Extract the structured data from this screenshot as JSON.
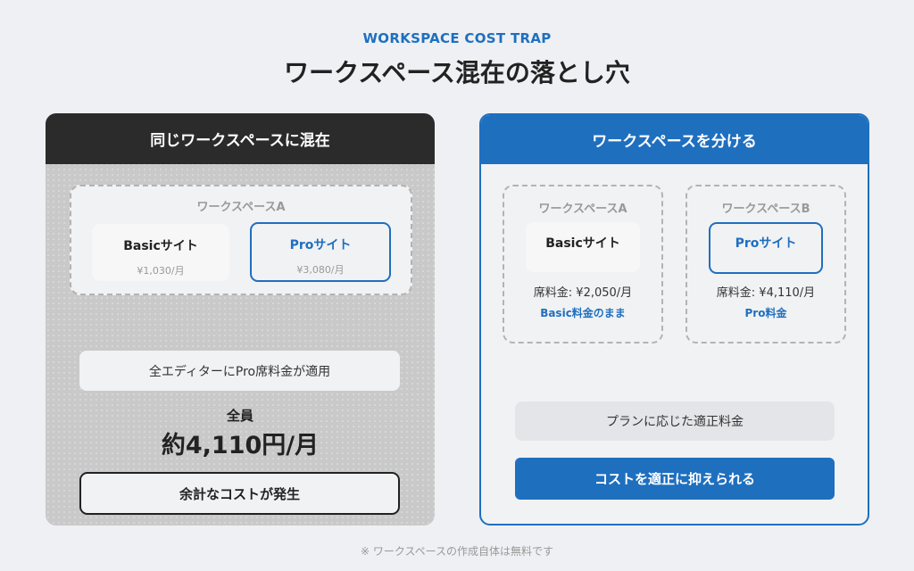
{
  "eyebrow": "WORKSPACE COST TRAP",
  "title": "ワークスペース混在の落とし穴",
  "left_panel": {
    "header": "同じワークスペースに混在",
    "workspace_label": "ワークスペースA",
    "basic_site": {
      "name": "Basicサイト",
      "price": "¥1,030/月"
    },
    "pro_site": {
      "name": "Proサイト",
      "price": "¥3,080/月"
    },
    "note": "全エディターにPro席料金が適用",
    "all_members": "全員",
    "total_price": "約4,110円/月",
    "result": "余計なコストが発生"
  },
  "right_panel": {
    "header": "ワークスペースを分ける",
    "workspace_a": {
      "label": "ワークスペースA",
      "site": "Basicサイト",
      "seat_fee": "席料金: ¥2,050/月",
      "fee_note": "Basic料金のまま"
    },
    "workspace_b": {
      "label": "ワークスペースB",
      "site": "Proサイト",
      "seat_fee": "席料金: ¥4,110/月",
      "fee_note": "Pro料金"
    },
    "note": "プランに応じた適正料金",
    "result": "コストを適正に抑えられる"
  },
  "footnote": "※ ワークスペースの作成自体は無料です",
  "colors": {
    "accent": "#1f6fbf",
    "dark_header": "#2b2b2b",
    "background": "#eef0f3"
  }
}
